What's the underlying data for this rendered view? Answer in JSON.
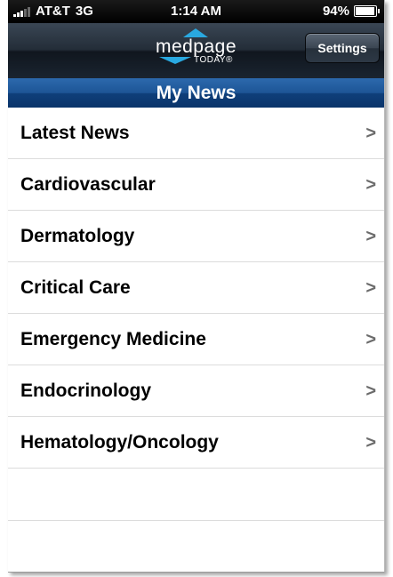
{
  "status_bar": {
    "carrier": "AT&T",
    "network": "3G",
    "time": "1:14 AM",
    "battery_text": "94%",
    "battery_level": 0.94
  },
  "header": {
    "logo_main": "medpage",
    "logo_sub": "TODAY®",
    "settings_label": "Settings",
    "title": "My News",
    "colors": {
      "accent": "#29a9e1",
      "title_bar": "#1d5596"
    }
  },
  "news_list": {
    "items": [
      {
        "label": "Latest News",
        "chevron": ">"
      },
      {
        "label": "Cardiovascular",
        "chevron": ">"
      },
      {
        "label": "Dermatology",
        "chevron": ">"
      },
      {
        "label": "Critical Care",
        "chevron": ">"
      },
      {
        "label": "Emergency Medicine",
        "chevron": ">"
      },
      {
        "label": "Endocrinology",
        "chevron": ">"
      },
      {
        "label": "Hematology/Oncology",
        "chevron": ">"
      }
    ]
  }
}
